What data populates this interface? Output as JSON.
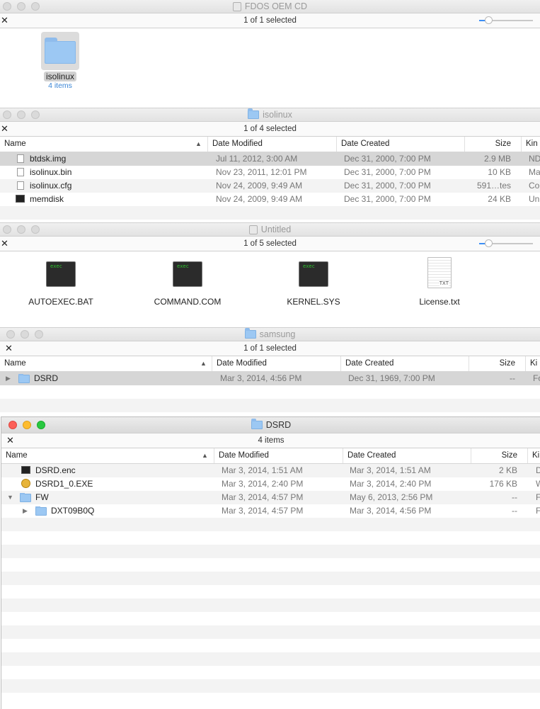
{
  "win1": {
    "title": "FDOS OEM CD",
    "status": "1 of 1 selected",
    "item": {
      "name": "isolinux",
      "sub": "4 items"
    }
  },
  "win2": {
    "title": "isolinux",
    "status": "1 of 4 selected",
    "columns": [
      "Name",
      "Date Modified",
      "Date Created",
      "Size",
      "Kin"
    ],
    "rows": [
      {
        "name": "btdsk.img",
        "modified": "Jul 11, 2012, 3:00 AM",
        "created": "Dec 31, 2000, 7:00 PM",
        "size": "2.9 MB",
        "kind": "ND"
      },
      {
        "name": "isolinux.bin",
        "modified": "Nov 23, 2011, 12:01 PM",
        "created": "Dec 31, 2000, 7:00 PM",
        "size": "10 KB",
        "kind": "Ma"
      },
      {
        "name": "isolinux.cfg",
        "modified": "Nov 24, 2009, 9:49 AM",
        "created": "Dec 31, 2000, 7:00 PM",
        "size": "591…tes",
        "kind": "Co"
      },
      {
        "name": "memdisk",
        "modified": "Nov 24, 2009, 9:49 AM",
        "created": "Dec 31, 2000, 7:00 PM",
        "size": "24 KB",
        "kind": "Un"
      }
    ]
  },
  "win3": {
    "title": "Untitled",
    "status": "1 of 5 selected",
    "icons": [
      {
        "label": "AUTOEXEC.BAT",
        "badge": "exec"
      },
      {
        "label": "COMMAND.COM",
        "badge": "exec"
      },
      {
        "label": "KERNEL.SYS",
        "badge": "exec"
      },
      {
        "label": "License.txt",
        "badge": "TXT"
      }
    ]
  },
  "win4": {
    "title": "samsung",
    "status": "1 of 1 selected",
    "columns": [
      "Name",
      "Date Modified",
      "Date Created",
      "Size",
      "Ki"
    ],
    "rows": [
      {
        "name": "DSRD",
        "modified": "Mar 3, 2014, 4:56 PM",
        "created": "Dec 31, 1969, 7:00 PM",
        "size": "--",
        "kind": "Fo"
      }
    ]
  },
  "win5": {
    "title": "DSRD",
    "status": "4 items",
    "columns": [
      "Name",
      "Date Modified",
      "Date Created",
      "Size",
      "Ki"
    ],
    "rows": [
      {
        "name": "DSRD.enc",
        "modified": "Mar 3, 2014, 1:51 AM",
        "created": "Mar 3, 2014, 1:51 AM",
        "size": "2 KB",
        "kind": "D"
      },
      {
        "name": "DSRD1_0.EXE",
        "modified": "Mar 3, 2014, 2:40 PM",
        "created": "Mar 3, 2014, 2:40 PM",
        "size": "176 KB",
        "kind": "W"
      },
      {
        "name": "FW",
        "modified": "Mar 3, 2014, 4:57 PM",
        "created": "May 6, 2013, 2:56 PM",
        "size": "--",
        "kind": "Fo"
      },
      {
        "name": "DXT09B0Q",
        "modified": "Mar 3, 2014, 4:57 PM",
        "created": "Mar 3, 2014, 4:56 PM",
        "size": "--",
        "kind": "Fo"
      }
    ]
  },
  "colors": {
    "selection": "#d6d6d6",
    "stripe": "#f3f3f3",
    "folder": "#9cc8f3",
    "accent": "#3d8ff5"
  }
}
